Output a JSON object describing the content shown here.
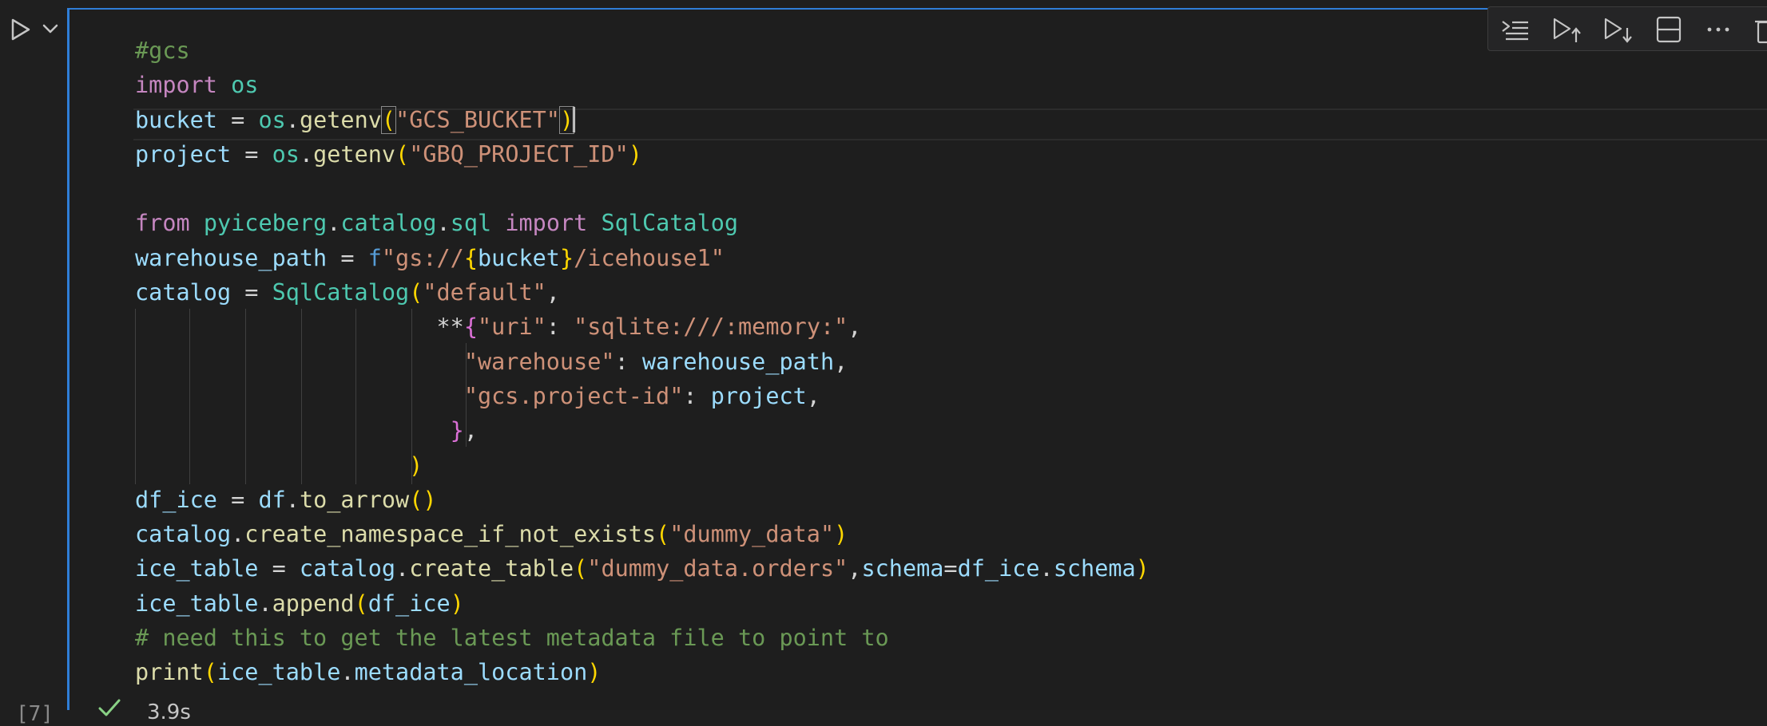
{
  "cell": {
    "execution_count": "[7]",
    "duration": "3.9s",
    "status": "success",
    "accent_color": "#2f7ed8"
  },
  "run_controls": {
    "run_icon": "play-icon",
    "menu_icon": "chevron-down-icon"
  },
  "toolbar": {
    "icons": [
      "run-by-line-icon",
      "execute-above-icon",
      "execute-below-icon",
      "split-cell-icon",
      "more-icon",
      "delete-icon"
    ]
  },
  "code": {
    "l1": {
      "t1": "#gcs"
    },
    "l2": {
      "t1": "import",
      "t2": " ",
      "t3": "os"
    },
    "l3": {
      "t1": "bucket",
      "t2": " = ",
      "t3": "os",
      "t4": ".",
      "t5": "getenv",
      "t6": "(",
      "t7": "\"GCS_BUCKET\"",
      "t8": ")"
    },
    "l4": {
      "t1": "project",
      "t2": " = ",
      "t3": "os",
      "t4": ".",
      "t5": "getenv",
      "t6": "(",
      "t7": "\"GBQ_PROJECT_ID\"",
      "t8": ")"
    },
    "l5": {
      "t1": ""
    },
    "l6": {
      "t1": "from",
      "t2": " ",
      "t3": "pyiceberg",
      "t4": ".",
      "t5": "catalog",
      "t6": ".",
      "t7": "sql",
      "t8": " ",
      "t9": "import",
      "t10": " ",
      "t11": "SqlCatalog"
    },
    "l7": {
      "t1": "warehouse_path",
      "t2": " = ",
      "t3": "f",
      "t4": "\"gs://",
      "t5": "{",
      "t6": "bucket",
      "t7": "}",
      "t8": "/icehouse1\""
    },
    "l8": {
      "t1": "catalog",
      "t2": " = ",
      "t3": "SqlCatalog",
      "t4": "(",
      "t5": "\"default\"",
      "t6": ","
    },
    "l9": {
      "t1": "                      ",
      "t2": "**",
      "t3": "{",
      "t4": "\"uri\"",
      "t5": ": ",
      "t6": "\"sqlite:///:memory:\"",
      "t7": ","
    },
    "l10": {
      "t1": "                        ",
      "t2": "\"warehouse\"",
      "t3": ": ",
      "t4": "warehouse_path",
      "t5": ","
    },
    "l11": {
      "t1": "                        ",
      "t2": "\"gcs.project-id\"",
      "t3": ": ",
      "t4": "project",
      "t5": ","
    },
    "l12": {
      "t1": "                       ",
      "t2": "}",
      "t3": ","
    },
    "l13": {
      "t1": "                    ",
      "t2": ")"
    },
    "l14": {
      "t1": "df_ice",
      "t2": " = ",
      "t3": "df",
      "t4": ".",
      "t5": "to_arrow",
      "t6": "()"
    },
    "l15": {
      "t1": "catalog",
      "t2": ".",
      "t3": "create_namespace_if_not_exists",
      "t4": "(",
      "t5": "\"dummy_data\"",
      "t6": ")"
    },
    "l16": {
      "t1": "ice_table",
      "t2": " = ",
      "t3": "catalog",
      "t4": ".",
      "t5": "create_table",
      "t6": "(",
      "t7": "\"dummy_data.orders\"",
      "t8": ",",
      "t9": "schema",
      "t10": "=",
      "t11": "df_ice",
      "t12": ".",
      "t13": "schema",
      "t14": ")"
    },
    "l17": {
      "t1": "ice_table",
      "t2": ".",
      "t3": "append",
      "t4": "(",
      "t5": "df_ice",
      "t6": ")"
    },
    "l18": {
      "t1": "# need this to get the latest metadata file to point to"
    },
    "l19": {
      "t1": "print",
      "t2": "(",
      "t3": "ice_table",
      "t4": ".",
      "t5": "metadata_location",
      "t6": ")"
    }
  }
}
